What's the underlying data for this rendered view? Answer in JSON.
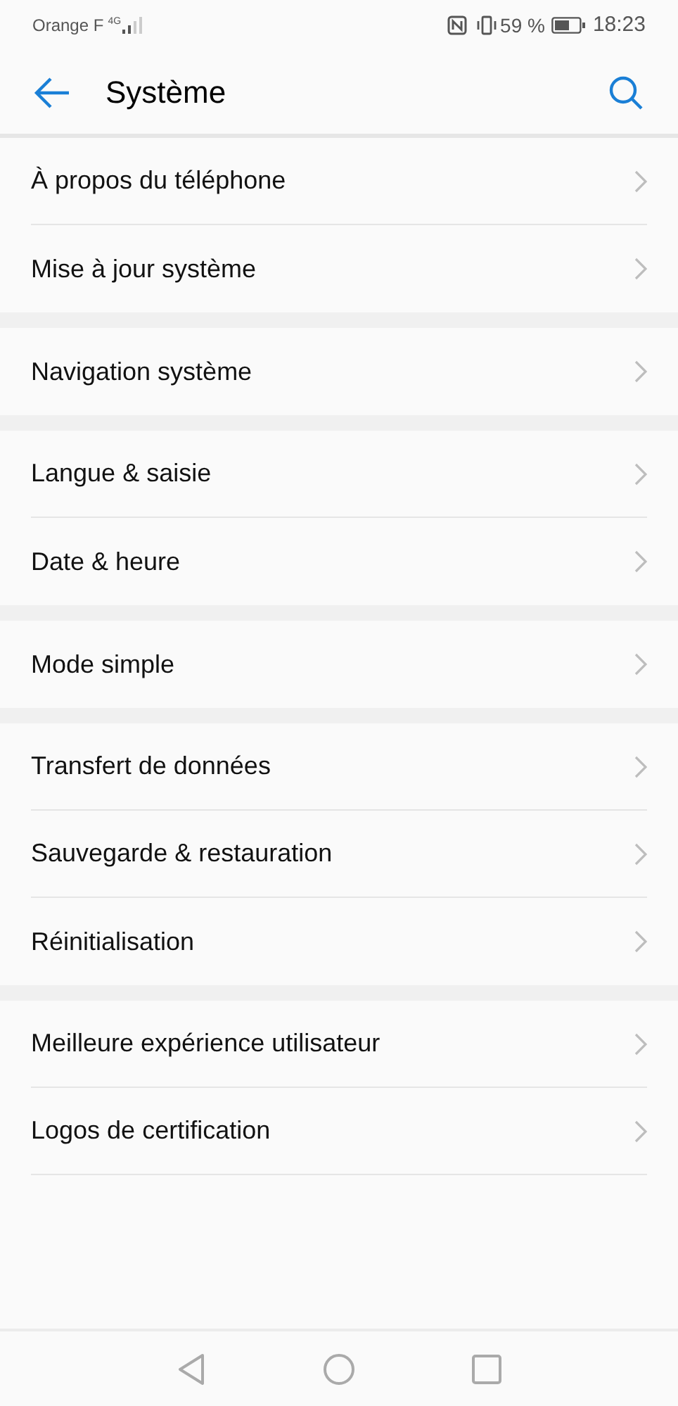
{
  "status_bar": {
    "carrier": "Orange F",
    "network": "4G",
    "battery": "59 %",
    "time": "18:23"
  },
  "header": {
    "title": "Système"
  },
  "groups": [
    {
      "items": [
        "À propos du téléphone",
        "Mise à jour système"
      ]
    },
    {
      "items": [
        "Navigation système"
      ]
    },
    {
      "items": [
        "Langue & saisie",
        "Date & heure"
      ]
    },
    {
      "items": [
        "Mode simple"
      ]
    },
    {
      "items": [
        "Transfert de données",
        "Sauvegarde & restauration",
        "Réinitialisation"
      ]
    },
    {
      "items": [
        "Meilleure expérience utilisateur",
        "Logos de certification"
      ]
    }
  ]
}
